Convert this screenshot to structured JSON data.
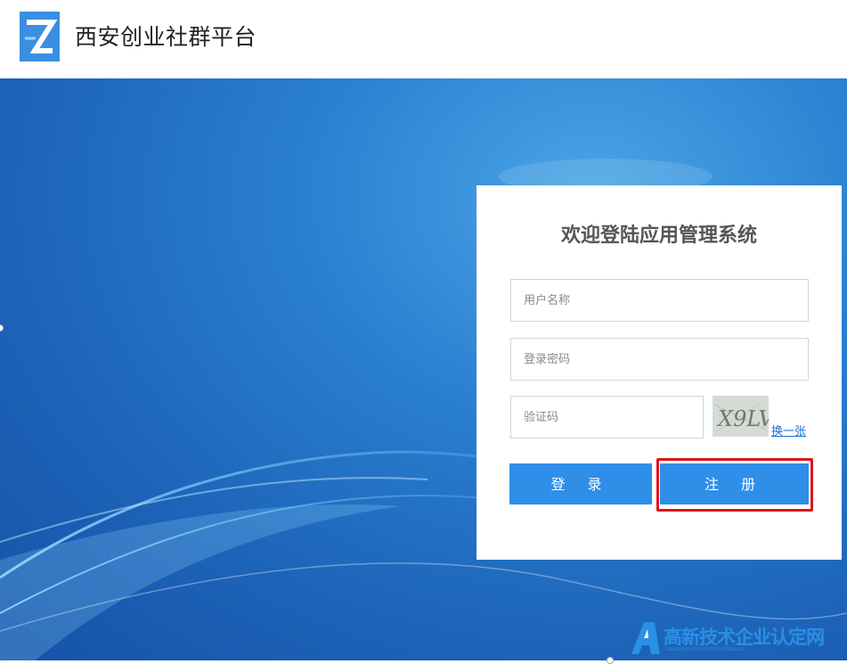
{
  "header": {
    "title": "西安创业社群平台",
    "logo_icon": "z-logo-icon",
    "logo_color": "#3b8fe0"
  },
  "login": {
    "title": "欢迎登陆应用管理系统",
    "username_placeholder": "用户名称",
    "password_placeholder": "登录密码",
    "captcha_placeholder": "验证码",
    "captcha_image": "captcha-image",
    "captcha_text": "X9LV",
    "swap_link": "换一张",
    "login_button": "登 录",
    "register_button": "注 册",
    "button_color": "#2f8ee8",
    "highlight_color": "#e0151c"
  },
  "watermark": {
    "title": "高新技术企业认定网",
    "subtitle": "GAOXINJISHUQIYERENDINGWANG",
    "icon": "letter-a-logo-icon"
  }
}
